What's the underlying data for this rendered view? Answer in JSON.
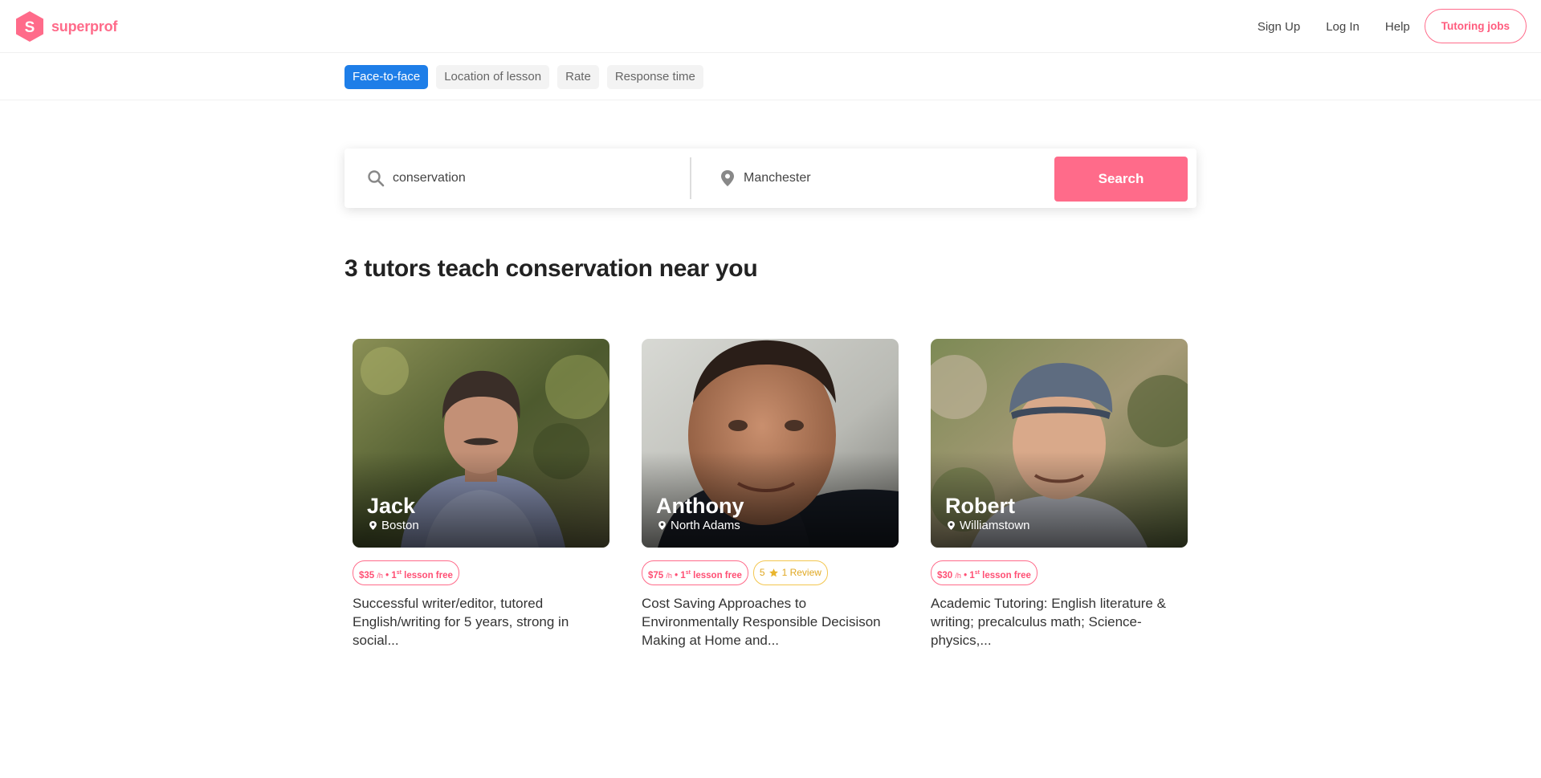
{
  "brand": {
    "name": "superprof",
    "mark_letter": "S",
    "color": "#ff6b8a"
  },
  "nav": {
    "sign_up": "Sign Up",
    "log_in": "Log In",
    "help": "Help",
    "tutoring_jobs": "Tutoring jobs"
  },
  "filters": [
    {
      "label": "Face-to-face",
      "active": true
    },
    {
      "label": "Location of lesson",
      "active": false
    },
    {
      "label": "Rate",
      "active": false
    },
    {
      "label": "Response time",
      "active": false
    }
  ],
  "search": {
    "subject": "conservation",
    "location": "Manchester",
    "button": "Search"
  },
  "results_title": "3 tutors teach conservation near you",
  "tutors": [
    {
      "name": "Jack",
      "city": "Boston",
      "price": "$35",
      "unit": "/h",
      "free_lesson": "1st lesson free",
      "rating": null,
      "reviews": null,
      "description": "Successful writer/editor, tutored English/writing for 5 years, strong in social..."
    },
    {
      "name": "Anthony",
      "city": "North Adams",
      "price": "$75",
      "unit": "/h",
      "free_lesson": "1st lesson free",
      "rating": "5",
      "reviews": "1 Review",
      "description": "Cost Saving Approaches to Environmentally Responsible Decisison Making at Home and..."
    },
    {
      "name": "Robert",
      "city": "Williamstown",
      "price": "$30",
      "unit": "/h",
      "free_lesson": "1st lesson free",
      "rating": null,
      "reviews": null,
      "description": "Academic Tutoring: English literature & writing; precalculus math; Science- physics,..."
    }
  ],
  "colors": {
    "accent": "#ff6b8a",
    "active_chip": "#1e7ee8",
    "review": "#f3c64f"
  }
}
